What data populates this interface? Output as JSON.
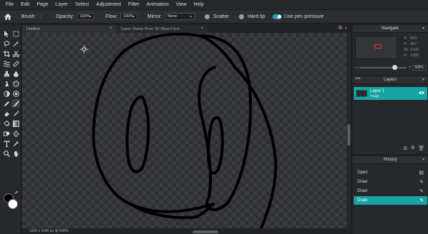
{
  "menu": [
    "File",
    "Edit",
    "Page",
    "Layer",
    "Select",
    "Adjustment",
    "Filter",
    "Animation",
    "View",
    "Help"
  ],
  "toolbar": {
    "brush_label": "Brush:",
    "opacity_label": "Opacity:",
    "opacity_value": "100%",
    "flow_label": "Flow:",
    "flow_value": "100%",
    "mirror_label": "Mirror:",
    "mirror_value": "None",
    "scatter_label": "Scatter",
    "hard_tip_label": "Hard tip",
    "pressure_label": "Use pen pressure",
    "pressure_enabled": true
  },
  "tabs": [
    {
      "label": "Untitled"
    },
    {
      "label": "Super Sheep Pose 3D Blast Flicki..."
    }
  ],
  "status": {
    "text": "1920 x 1080 px @ 500%"
  },
  "navigate": {
    "title": "Navigate",
    "x_label": "X:",
    "x_value": "860",
    "y_label": "Y:",
    "y_value": "487",
    "w_label": "W:",
    "w_value": "1920",
    "h_label": "H:",
    "h_value": "1080",
    "zoom_value": "500%",
    "zoom_slider_level_percent": 72
  },
  "layers": {
    "title": "Layers",
    "items": [
      {
        "name": "Layer 1",
        "type": "Image",
        "visible": true,
        "selected": true
      }
    ]
  },
  "history": {
    "title": "History",
    "items": [
      {
        "label": "Open",
        "icon": "file-icon",
        "active": false
      },
      {
        "label": "Draw",
        "icon": "brush-icon",
        "active": false
      },
      {
        "label": "Draw",
        "icon": "brush-icon",
        "active": false
      },
      {
        "label": "Draw",
        "icon": "brush-icon",
        "active": true
      }
    ]
  },
  "colors": {
    "accent": "#15a5a5",
    "foreground": "#000000",
    "background": "#ffffff"
  }
}
